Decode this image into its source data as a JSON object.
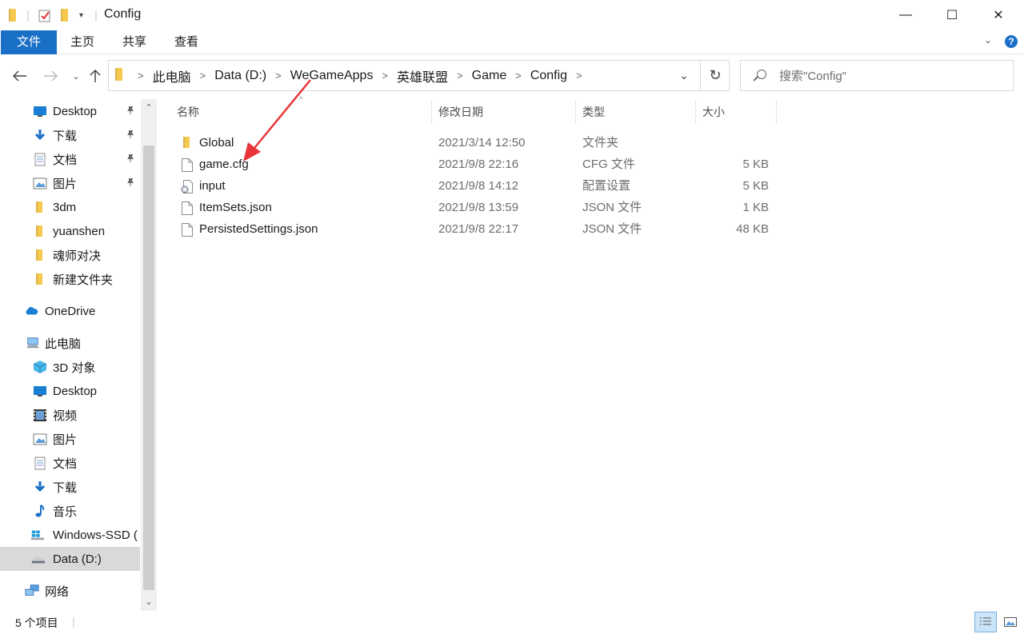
{
  "window": {
    "title": "Config",
    "minimize_glyph": "—",
    "maximize_glyph": "☐",
    "close_glyph": "✕"
  },
  "ribbon": {
    "tabs": [
      "文件",
      "主页",
      "共享",
      "查看"
    ]
  },
  "address": {
    "crumbs": [
      "此电脑",
      "Data (D:)",
      "WeGameApps",
      "英雄联盟",
      "Game",
      "Config"
    ]
  },
  "search": {
    "placeholder": "搜索\"Config\""
  },
  "columns": {
    "name": "名称",
    "date": "修改日期",
    "type": "类型",
    "size": "大小"
  },
  "files": [
    {
      "name": "Global",
      "date": "2021/3/14 12:50",
      "type": "文件夹",
      "size": "",
      "icon": "folder-icon"
    },
    {
      "name": "game.cfg",
      "date": "2021/9/8 22:16",
      "type": "CFG 文件",
      "size": "5 KB",
      "icon": "file-icon"
    },
    {
      "name": "input",
      "date": "2021/9/8 14:12",
      "type": "配置设置",
      "size": "5 KB",
      "icon": "config-file-icon"
    },
    {
      "name": "ItemSets.json",
      "date": "2021/9/8 13:59",
      "type": "JSON 文件",
      "size": "1 KB",
      "icon": "file-icon"
    },
    {
      "name": "PersistedSettings.json",
      "date": "2021/9/8 22:17",
      "type": "JSON 文件",
      "size": "48 KB",
      "icon": "file-icon"
    }
  ],
  "sidebar": {
    "items": [
      {
        "label": "Desktop",
        "icon": "desktop-icon"
      },
      {
        "label": "下载",
        "icon": "download-icon"
      },
      {
        "label": "文档",
        "icon": "documents-icon"
      },
      {
        "label": "图片",
        "icon": "pictures-icon"
      },
      {
        "label": "3dm",
        "icon": "folder-icon"
      },
      {
        "label": "yuanshen",
        "icon": "folder-icon"
      },
      {
        "label": "魂师对决",
        "icon": "folder-icon"
      },
      {
        "label": "新建文件夹",
        "icon": "folder-icon"
      },
      {
        "label": "OneDrive",
        "icon": "onedrive-icon"
      },
      {
        "label": "此电脑",
        "icon": "this-pc-icon"
      },
      {
        "label": "3D 对象",
        "icon": "3d-objects-icon"
      },
      {
        "label": "Desktop",
        "icon": "desktop-icon"
      },
      {
        "label": "视频",
        "icon": "videos-icon"
      },
      {
        "label": "图片",
        "icon": "pictures-icon"
      },
      {
        "label": "文档",
        "icon": "documents-icon"
      },
      {
        "label": "下载",
        "icon": "download-icon"
      },
      {
        "label": "音乐",
        "icon": "music-icon"
      },
      {
        "label": "Windows-SSD (",
        "icon": "windows-drive-icon"
      },
      {
        "label": "Data (D:)",
        "icon": "drive-icon"
      },
      {
        "label": "网络",
        "icon": "network-icon"
      }
    ]
  },
  "status": {
    "item_count": "5 个项目"
  },
  "colors": {
    "accent": "#1a6fc7",
    "annotation_arrow": "#e8353a",
    "folder": "#f5c94e"
  }
}
